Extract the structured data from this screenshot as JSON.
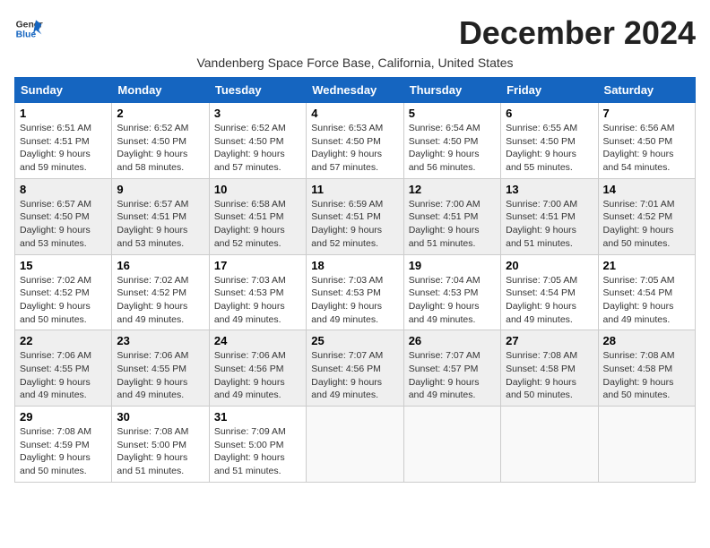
{
  "header": {
    "logo_line1": "General",
    "logo_line2": "Blue",
    "month_title": "December 2024",
    "subtitle": "Vandenberg Space Force Base, California, United States"
  },
  "calendar": {
    "weekdays": [
      "Sunday",
      "Monday",
      "Tuesday",
      "Wednesday",
      "Thursday",
      "Friday",
      "Saturday"
    ],
    "weeks": [
      [
        {
          "day": "1",
          "sunrise": "6:51 AM",
          "sunset": "4:51 PM",
          "daylight": "9 hours and 59 minutes."
        },
        {
          "day": "2",
          "sunrise": "6:52 AM",
          "sunset": "4:50 PM",
          "daylight": "9 hours and 58 minutes."
        },
        {
          "day": "3",
          "sunrise": "6:52 AM",
          "sunset": "4:50 PM",
          "daylight": "9 hours and 57 minutes."
        },
        {
          "day": "4",
          "sunrise": "6:53 AM",
          "sunset": "4:50 PM",
          "daylight": "9 hours and 57 minutes."
        },
        {
          "day": "5",
          "sunrise": "6:54 AM",
          "sunset": "4:50 PM",
          "daylight": "9 hours and 56 minutes."
        },
        {
          "day": "6",
          "sunrise": "6:55 AM",
          "sunset": "4:50 PM",
          "daylight": "9 hours and 55 minutes."
        },
        {
          "day": "7",
          "sunrise": "6:56 AM",
          "sunset": "4:50 PM",
          "daylight": "9 hours and 54 minutes."
        }
      ],
      [
        {
          "day": "8",
          "sunrise": "6:57 AM",
          "sunset": "4:50 PM",
          "daylight": "9 hours and 53 minutes."
        },
        {
          "day": "9",
          "sunrise": "6:57 AM",
          "sunset": "4:51 PM",
          "daylight": "9 hours and 53 minutes."
        },
        {
          "day": "10",
          "sunrise": "6:58 AM",
          "sunset": "4:51 PM",
          "daylight": "9 hours and 52 minutes."
        },
        {
          "day": "11",
          "sunrise": "6:59 AM",
          "sunset": "4:51 PM",
          "daylight": "9 hours and 52 minutes."
        },
        {
          "day": "12",
          "sunrise": "7:00 AM",
          "sunset": "4:51 PM",
          "daylight": "9 hours and 51 minutes."
        },
        {
          "day": "13",
          "sunrise": "7:00 AM",
          "sunset": "4:51 PM",
          "daylight": "9 hours and 51 minutes."
        },
        {
          "day": "14",
          "sunrise": "7:01 AM",
          "sunset": "4:52 PM",
          "daylight": "9 hours and 50 minutes."
        }
      ],
      [
        {
          "day": "15",
          "sunrise": "7:02 AM",
          "sunset": "4:52 PM",
          "daylight": "9 hours and 50 minutes."
        },
        {
          "day": "16",
          "sunrise": "7:02 AM",
          "sunset": "4:52 PM",
          "daylight": "9 hours and 49 minutes."
        },
        {
          "day": "17",
          "sunrise": "7:03 AM",
          "sunset": "4:53 PM",
          "daylight": "9 hours and 49 minutes."
        },
        {
          "day": "18",
          "sunrise": "7:03 AM",
          "sunset": "4:53 PM",
          "daylight": "9 hours and 49 minutes."
        },
        {
          "day": "19",
          "sunrise": "7:04 AM",
          "sunset": "4:53 PM",
          "daylight": "9 hours and 49 minutes."
        },
        {
          "day": "20",
          "sunrise": "7:05 AM",
          "sunset": "4:54 PM",
          "daylight": "9 hours and 49 minutes."
        },
        {
          "day": "21",
          "sunrise": "7:05 AM",
          "sunset": "4:54 PM",
          "daylight": "9 hours and 49 minutes."
        }
      ],
      [
        {
          "day": "22",
          "sunrise": "7:06 AM",
          "sunset": "4:55 PM",
          "daylight": "9 hours and 49 minutes."
        },
        {
          "day": "23",
          "sunrise": "7:06 AM",
          "sunset": "4:55 PM",
          "daylight": "9 hours and 49 minutes."
        },
        {
          "day": "24",
          "sunrise": "7:06 AM",
          "sunset": "4:56 PM",
          "daylight": "9 hours and 49 minutes."
        },
        {
          "day": "25",
          "sunrise": "7:07 AM",
          "sunset": "4:56 PM",
          "daylight": "9 hours and 49 minutes."
        },
        {
          "day": "26",
          "sunrise": "7:07 AM",
          "sunset": "4:57 PM",
          "daylight": "9 hours and 49 minutes."
        },
        {
          "day": "27",
          "sunrise": "7:08 AM",
          "sunset": "4:58 PM",
          "daylight": "9 hours and 50 minutes."
        },
        {
          "day": "28",
          "sunrise": "7:08 AM",
          "sunset": "4:58 PM",
          "daylight": "9 hours and 50 minutes."
        }
      ],
      [
        {
          "day": "29",
          "sunrise": "7:08 AM",
          "sunset": "4:59 PM",
          "daylight": "9 hours and 50 minutes."
        },
        {
          "day": "30",
          "sunrise": "7:08 AM",
          "sunset": "5:00 PM",
          "daylight": "9 hours and 51 minutes."
        },
        {
          "day": "31",
          "sunrise": "7:09 AM",
          "sunset": "5:00 PM",
          "daylight": "9 hours and 51 minutes."
        },
        null,
        null,
        null,
        null
      ]
    ]
  }
}
